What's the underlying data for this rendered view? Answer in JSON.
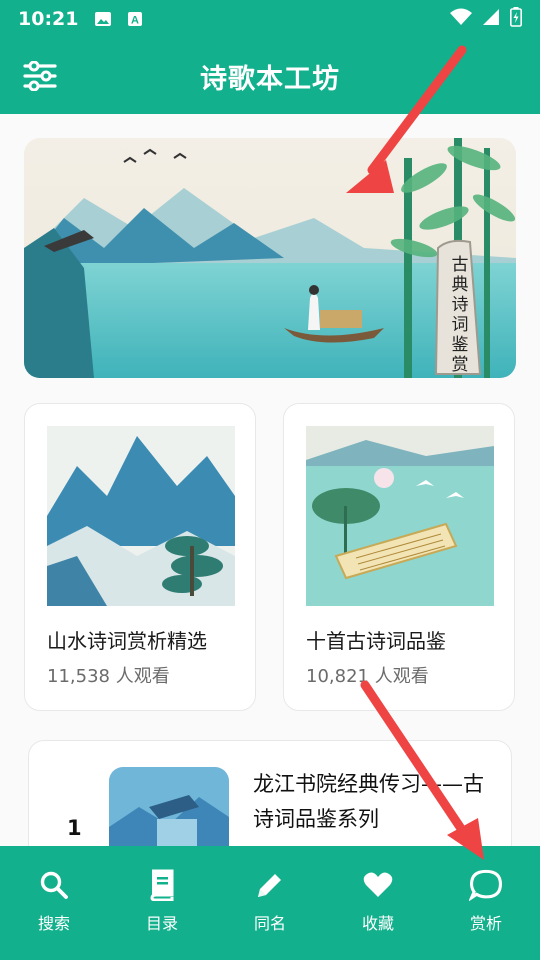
{
  "status_bar": {
    "time": "10:21",
    "icons": [
      "image-icon",
      "a-letter-icon",
      "wifi-icon",
      "signal-icon",
      "battery-icon"
    ]
  },
  "app_bar": {
    "title": "诗歌本工坊",
    "menu_icon": "sliders-icon"
  },
  "banner": {
    "stone_text": "古典诗词鉴赏"
  },
  "cards": [
    {
      "title": "山水诗词赏析精选",
      "views": "11,538 人观看"
    },
    {
      "title": "十首古诗词品鉴",
      "views": "10,821 人观看"
    }
  ],
  "list": [
    {
      "rank": "1",
      "title": "龙江书院经典传习——古诗词品鉴系列"
    }
  ],
  "bottom_nav": {
    "items": [
      {
        "label": "搜索",
        "icon": "search-icon"
      },
      {
        "label": "目录",
        "icon": "book-icon"
      },
      {
        "label": "同名",
        "icon": "pencil-icon"
      },
      {
        "label": "收藏",
        "icon": "heart-icon"
      },
      {
        "label": "赏析",
        "icon": "chat-bubble-icon"
      }
    ]
  },
  "colors": {
    "primary": "#12b08c",
    "annotation_arrow": "#ef4444"
  }
}
